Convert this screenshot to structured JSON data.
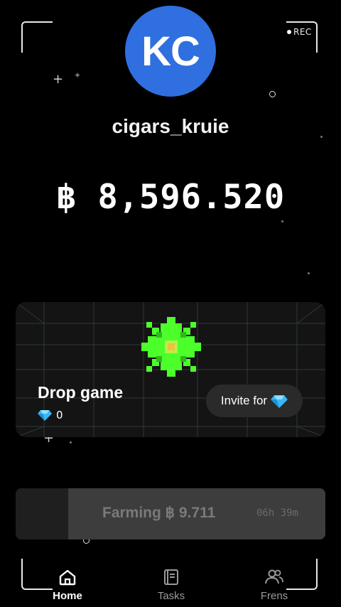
{
  "camera": {
    "rec_label": "REC"
  },
  "profile": {
    "initials": "KC",
    "avatar_color": "#2f6fe0",
    "username": "cigars_kruie"
  },
  "balance": {
    "currency_symbol": "฿",
    "amount": "8,596.520",
    "text": "฿ 8,596.520"
  },
  "drop_game": {
    "title": "Drop game",
    "gem_count": "0",
    "gem_icon": "diamond-icon",
    "invite_label": "Invite for",
    "accent": "#4cff2a"
  },
  "farming": {
    "label": "Farming ฿ 9.711",
    "time_left": "06h 39m",
    "progress": 0.17
  },
  "nav": {
    "items": [
      {
        "label": "Home",
        "icon": "home-icon",
        "active": true
      },
      {
        "label": "Tasks",
        "icon": "book-icon",
        "active": false
      },
      {
        "label": "Frens",
        "icon": "friends-icon",
        "active": false
      }
    ]
  }
}
